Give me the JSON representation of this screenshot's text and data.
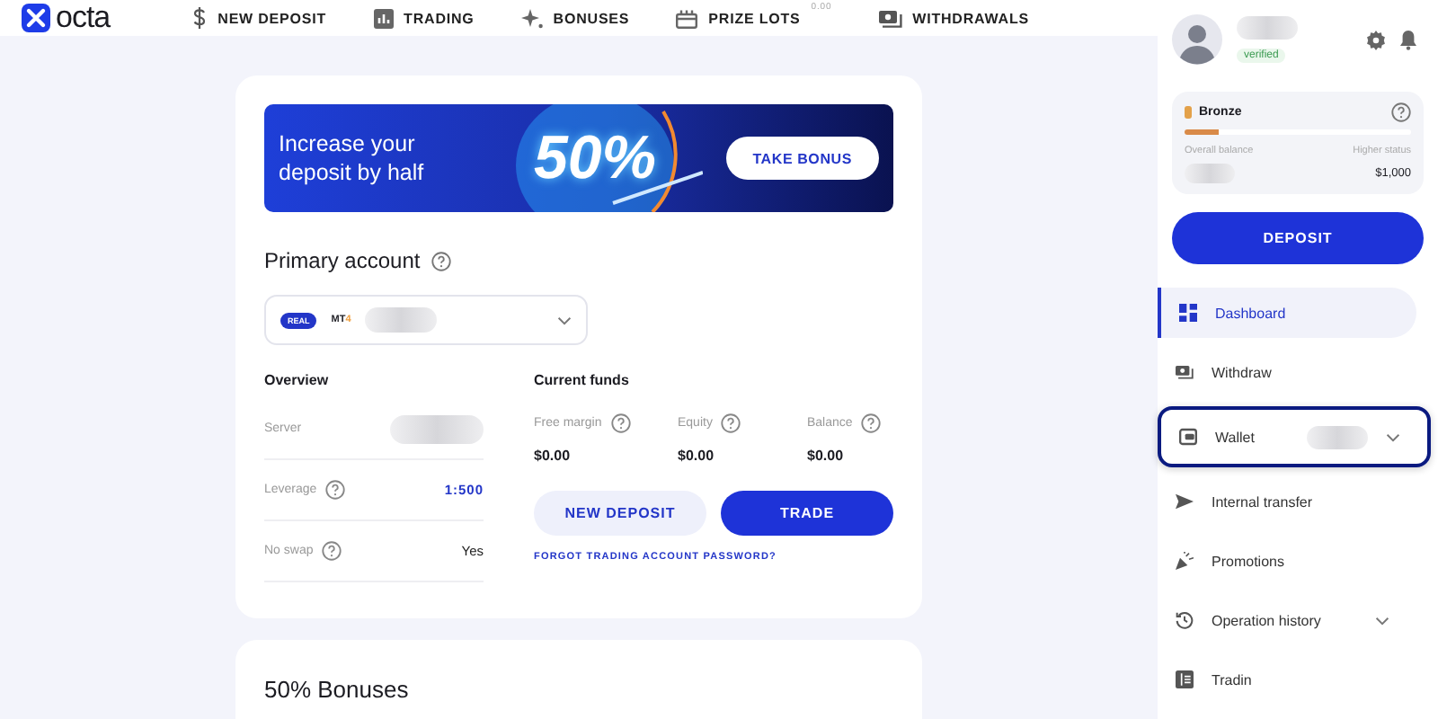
{
  "brand": "octa",
  "nav": [
    {
      "label": "NEW DEPOSIT"
    },
    {
      "label": "TRADING"
    },
    {
      "label": "BONUSES"
    },
    {
      "label": "PRIZE LOTS",
      "badge": "0.00"
    },
    {
      "label": "WITHDRAWALS"
    }
  ],
  "banner": {
    "title": "Increase your deposit by half",
    "highlight": "50%",
    "button": "TAKE BONUS"
  },
  "account": {
    "title": "Primary account",
    "type_badge": "REAL",
    "platform": "MT",
    "platform_version": "4"
  },
  "overview": {
    "title": "Overview",
    "rows": [
      {
        "label": "Server",
        "help": false,
        "redacted": true,
        "accent": false
      },
      {
        "label": "Leverage",
        "help": true,
        "value": "1:500",
        "redacted": false,
        "accent": true
      },
      {
        "label": "No swap",
        "help": true,
        "value": "Yes",
        "redacted": false,
        "accent": false
      }
    ]
  },
  "funds": {
    "title": "Current funds",
    "items": [
      {
        "label": "Free margin",
        "value": "$0.00"
      },
      {
        "label": "Equity",
        "value": "$0.00"
      },
      {
        "label": "Balance",
        "value": "$0.00"
      }
    ],
    "secondary_button": "NEW DEPOSIT",
    "primary_button": "TRADE",
    "link": "FORGOT TRADING ACCOUNT PASSWORD?"
  },
  "bonuses": {
    "title": "50% Bonuses"
  },
  "profile": {
    "status": "verified"
  },
  "tier": {
    "name": "Bronze",
    "level": 0.15,
    "left_label": "Overall balance",
    "right_label": "Higher status",
    "right_value": "$1,000"
  },
  "deposit_button": "DEPOSIT",
  "menu": [
    {
      "label": "Dashboard",
      "selected": true,
      "focused": false,
      "dropdown": false,
      "redacted": false
    },
    {
      "label": "Withdraw",
      "selected": false,
      "focused": false,
      "dropdown": false,
      "redacted": false
    },
    {
      "label": "Wallet",
      "selected": false,
      "focused": true,
      "dropdown": true,
      "redacted": true
    },
    {
      "label": "Internal transfer",
      "selected": false,
      "focused": false,
      "dropdown": false,
      "redacted": false
    },
    {
      "label": "Promotions",
      "selected": false,
      "focused": false,
      "dropdown": false,
      "redacted": false
    },
    {
      "label": "Operation history",
      "selected": false,
      "focused": false,
      "dropdown": true,
      "redacted": false
    },
    {
      "label": "Tradin",
      "selected": false,
      "focused": false,
      "dropdown": false,
      "redacted": false
    }
  ]
}
